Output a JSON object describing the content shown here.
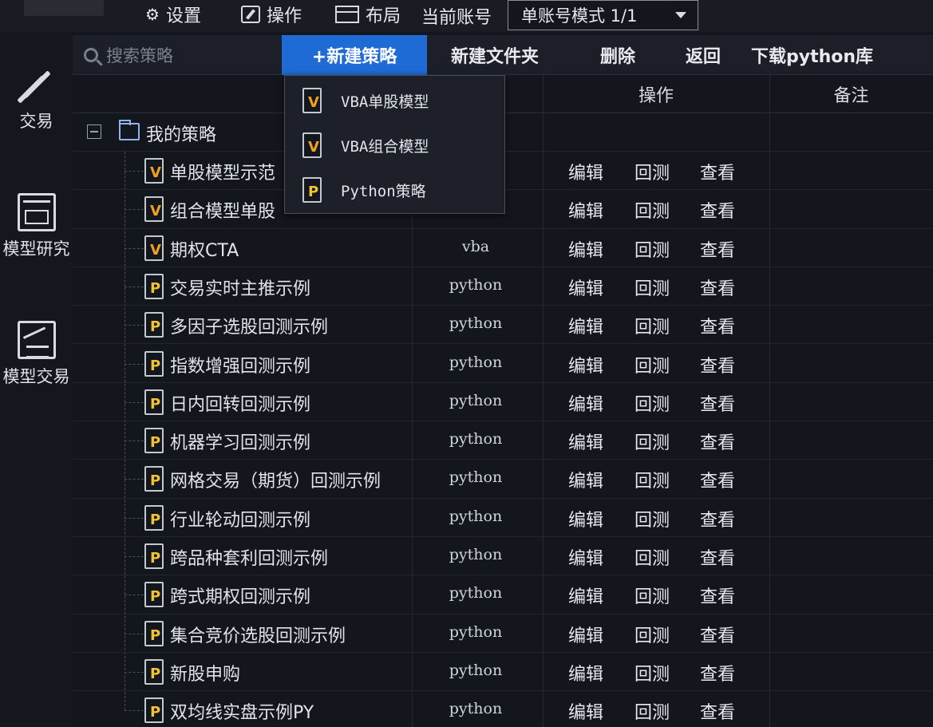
{
  "menubar": {
    "settings": "设置",
    "operation": "操作",
    "layout": "布局",
    "account_label": "当前账号",
    "account_mode": "单账号模式 1/1"
  },
  "sidebar": {
    "items": [
      {
        "label": "交易",
        "icon": "trade-icon"
      },
      {
        "label": "模型研究",
        "icon": "chart-window-icon"
      },
      {
        "label": "模型交易",
        "icon": "model-trade-icon"
      }
    ]
  },
  "toolbar": {
    "search_placeholder": "搜索策略",
    "new_strategy": "+新建策略",
    "new_folder": "新建文件夹",
    "delete": "删除",
    "back": "返回",
    "download_python": "下载python库"
  },
  "dropdown": {
    "items": [
      {
        "icon": "vba-file-icon",
        "label": "VBA单股模型"
      },
      {
        "icon": "vba-file-icon",
        "label": "VBA组合模型"
      },
      {
        "icon": "python-file-icon",
        "label": "Python策略"
      }
    ]
  },
  "table": {
    "headers": {
      "operation": "操作",
      "note": "备注"
    },
    "folder": "我的策略",
    "actions": {
      "edit": "编辑",
      "backtest": "回测",
      "view": "查看"
    },
    "rows": [
      {
        "name": "单股模型示范",
        "type": "v",
        "lang": ""
      },
      {
        "name": "组合模型单股",
        "type": "v",
        "lang": ""
      },
      {
        "name": "期权CTA",
        "type": "v",
        "lang": "vba"
      },
      {
        "name": "交易实时主推示例",
        "type": "p",
        "lang": "python"
      },
      {
        "name": "多因子选股回测示例",
        "type": "p",
        "lang": "python"
      },
      {
        "name": "指数增强回测示例",
        "type": "p",
        "lang": "python"
      },
      {
        "name": "日内回转回测示例",
        "type": "p",
        "lang": "python"
      },
      {
        "name": "机器学习回测示例",
        "type": "p",
        "lang": "python"
      },
      {
        "name": "网格交易（期货）回测示例",
        "type": "p",
        "lang": "python"
      },
      {
        "name": "行业轮动回测示例",
        "type": "p",
        "lang": "python"
      },
      {
        "name": "跨品种套利回测示例",
        "type": "p",
        "lang": "python"
      },
      {
        "name": "跨式期权回测示例",
        "type": "p",
        "lang": "python"
      },
      {
        "name": "集合竞价选股回测示例",
        "type": "p",
        "lang": "python"
      },
      {
        "name": "新股申购",
        "type": "p",
        "lang": "python"
      },
      {
        "name": "双均线实盘示例PY",
        "type": "p",
        "lang": "python"
      }
    ]
  }
}
